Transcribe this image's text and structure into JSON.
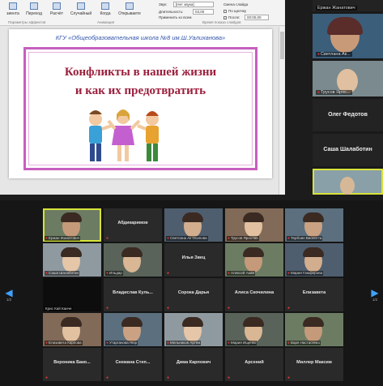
{
  "ribbon": {
    "buttons": [
      "Вставить",
      "Макет",
      "Сбросить",
      "Раздел",
      "Шрифт",
      "Абзац",
      "Рисование"
    ],
    "partial_labels": [
      "зиента",
      "Переход",
      "Расчёт",
      "Случайный",
      "Когда",
      "Открываете"
    ],
    "groups": [
      "Параметры эффектов",
      "Анимация",
      "Время показа слайдов"
    ],
    "start_label": "Звук:",
    "start_value": "[Нет звука]",
    "duration_label": "Длительность:",
    "duration_value": "03,00",
    "apply_all": "Применить ко всем",
    "advance_label": "Смена слайда",
    "on_click": "По щелчку",
    "after_label": "После:",
    "after_value": "00:00,00"
  },
  "slide": {
    "header": "КГУ «Общеобразовательная школа №8 им.Ш.Уалиханова»",
    "title_line1": "Конфликты в нашей жизни",
    "title_line2": "и как их предотвратить"
  },
  "strip": {
    "tiles": [
      {
        "name": "Ержан Жанатович",
        "type": "video"
      },
      {
        "name": "Светлана Ак...",
        "type": "video"
      },
      {
        "name": "Трусов Ярос...",
        "type": "video"
      },
      {
        "name": "Олег Федотов",
        "type": "name"
      },
      {
        "name": "Саша Шалаботин",
        "type": "name"
      },
      {
        "name": "",
        "type": "video",
        "active": true
      }
    ]
  },
  "gallery": {
    "page_left": "1/2",
    "page_right": "1/2",
    "rows": [
      [
        {
          "name": "Ержан Жанатович",
          "type": "video",
          "active": true
        },
        {
          "name": "Абдикаримов",
          "type": "name"
        },
        {
          "name": "Светлана Ак Осипова",
          "type": "video"
        },
        {
          "name": "Трусов Ярослав",
          "type": "video"
        },
        {
          "name": "Тербоин Виолетта",
          "type": "video"
        }
      ],
      [
        {
          "name": "Саша Шалаботин",
          "type": "video"
        },
        {
          "name": "Ильдар",
          "type": "video"
        },
        {
          "name": "Илья Звец",
          "type": "name"
        },
        {
          "name": "Алексей Аким",
          "type": "video"
        },
        {
          "name": "Мария Гаюфорова",
          "type": "video"
        }
      ],
      [
        {
          "name": "Крис Кай Каиче",
          "type": "dark"
        },
        {
          "name": "Владислав Куль...",
          "type": "name"
        },
        {
          "name": "Сорока Дарья",
          "type": "name"
        },
        {
          "name": "Алиса Скочилина",
          "type": "name"
        },
        {
          "name": "Елизавета",
          "type": "name"
        }
      ],
      [
        {
          "name": "Елизавета Карпова",
          "type": "video"
        },
        {
          "name": "Утарганова Нюр",
          "type": "video"
        },
        {
          "name": "Мельников Артём",
          "type": "video"
        },
        {
          "name": "Мария Ищенко",
          "type": "video"
        },
        {
          "name": "Варя Настасенко",
          "type": "video"
        }
      ],
      [
        {
          "name": "Вероника Бако...",
          "type": "name"
        },
        {
          "name": "Снежана Степ...",
          "type": "name"
        },
        {
          "name": "Дима Карпович",
          "type": "name"
        },
        {
          "name": "Арсений",
          "type": "name"
        },
        {
          "name": "Миллер Максим",
          "type": "name"
        }
      ]
    ]
  },
  "colors": {
    "active_border": "#d7e339",
    "nav_arrow": "#3fa1ff",
    "slide_frame": "#c65fbf",
    "slide_title": "#9b1f3c",
    "muted_mic": "#e23b3b"
  }
}
